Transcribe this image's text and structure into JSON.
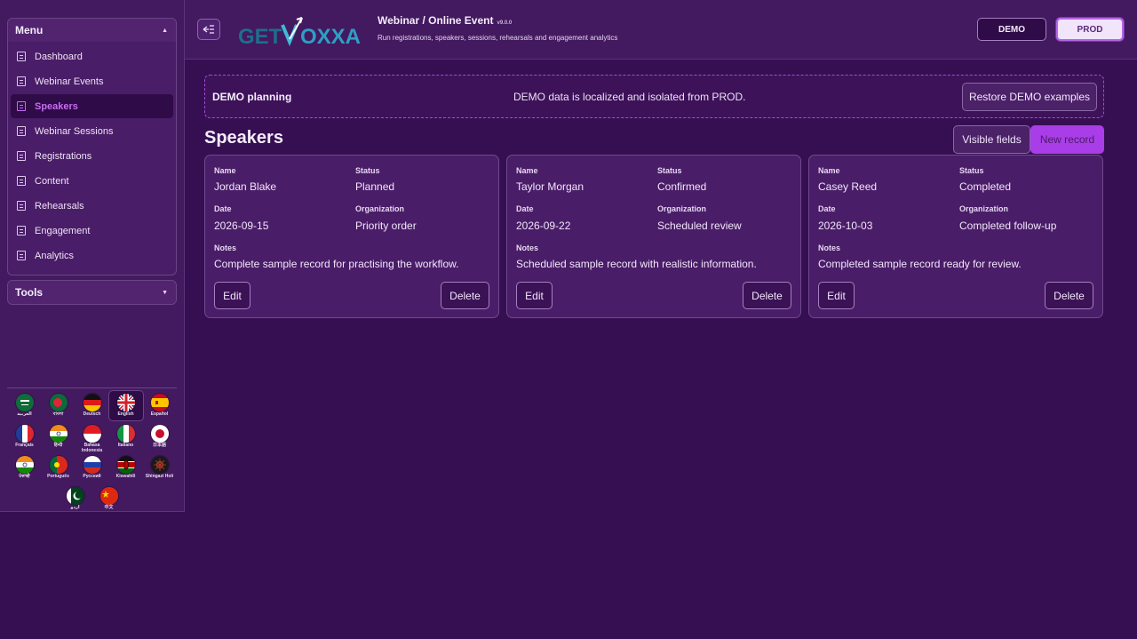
{
  "sidebar": {
    "menu_title": "Menu",
    "tools_title": "Tools",
    "items": [
      {
        "label": "Dashboard"
      },
      {
        "label": "Webinar Events"
      },
      {
        "label": "Speakers"
      },
      {
        "label": "Webinar Sessions"
      },
      {
        "label": "Registrations"
      },
      {
        "label": "Content"
      },
      {
        "label": "Rehearsals"
      },
      {
        "label": "Engagement"
      },
      {
        "label": "Analytics"
      }
    ],
    "active_item": "Speakers",
    "languages": [
      {
        "name": "العربية",
        "flag": "saudi-arabia"
      },
      {
        "name": "বাংলা",
        "flag": "bangladesh"
      },
      {
        "name": "Deutsch",
        "flag": "germany"
      },
      {
        "name": "English",
        "flag": "united-kingdom",
        "selected": true
      },
      {
        "name": "Español",
        "flag": "spain"
      },
      {
        "name": "Français",
        "flag": "france"
      },
      {
        "name": "हिन्दी",
        "flag": "india"
      },
      {
        "name": "Bahasa Indonesia",
        "flag": "indonesia"
      },
      {
        "name": "Italiano",
        "flag": "italy"
      },
      {
        "name": "日本語",
        "flag": "japan"
      },
      {
        "name": "ਪੰਜਾਬੀ",
        "flag": "india"
      },
      {
        "name": "Português",
        "flag": "portugal"
      },
      {
        "name": "Русский",
        "flag": "russia"
      },
      {
        "name": "Kiswahili",
        "flag": "kenya"
      },
      {
        "name": "Shingazi Holi",
        "flag": "dark-emblem"
      },
      {
        "name": "اردو",
        "flag": "pakistan"
      },
      {
        "name": "中文",
        "flag": "china"
      }
    ]
  },
  "header": {
    "logo_text_left": "GET",
    "logo_text_right": "OXXA",
    "title": "Webinar / Online Event",
    "version": "v9.0.0",
    "subtitle": "Run registrations, speakers, sessions, rehearsals and engagement analytics",
    "demo_label": "DEMO",
    "prod_label": "PROD",
    "active_env": "PROD"
  },
  "banner": {
    "title": "DEMO planning",
    "message": "DEMO data is localized and isolated from PROD.",
    "restore_label": "Restore DEMO examples"
  },
  "main": {
    "page_title": "Speakers",
    "visible_fields_label": "Visible fields",
    "new_record_label": "New record",
    "labels": {
      "name": "Name",
      "status": "Status",
      "date": "Date",
      "organization": "Organization",
      "notes": "Notes",
      "edit": "Edit",
      "delete": "Delete"
    },
    "cards": [
      {
        "name": "Jordan Blake",
        "status": "Planned",
        "date": "2026-09-15",
        "organization": "Priority order",
        "notes": "Complete sample record for practising the workflow."
      },
      {
        "name": "Taylor Morgan",
        "status": "Confirmed",
        "date": "2026-09-22",
        "organization": "Scheduled review",
        "notes": "Scheduled sample record with realistic information."
      },
      {
        "name": "Casey Reed",
        "status": "Completed",
        "date": "2026-10-03",
        "organization": "Completed follow-up",
        "notes": "Completed sample record ready for review."
      }
    ]
  },
  "colors": {
    "background": "#360e52",
    "sidebar": "#43195f",
    "accent": "#a93ee8",
    "active_text": "#c86bf5"
  }
}
